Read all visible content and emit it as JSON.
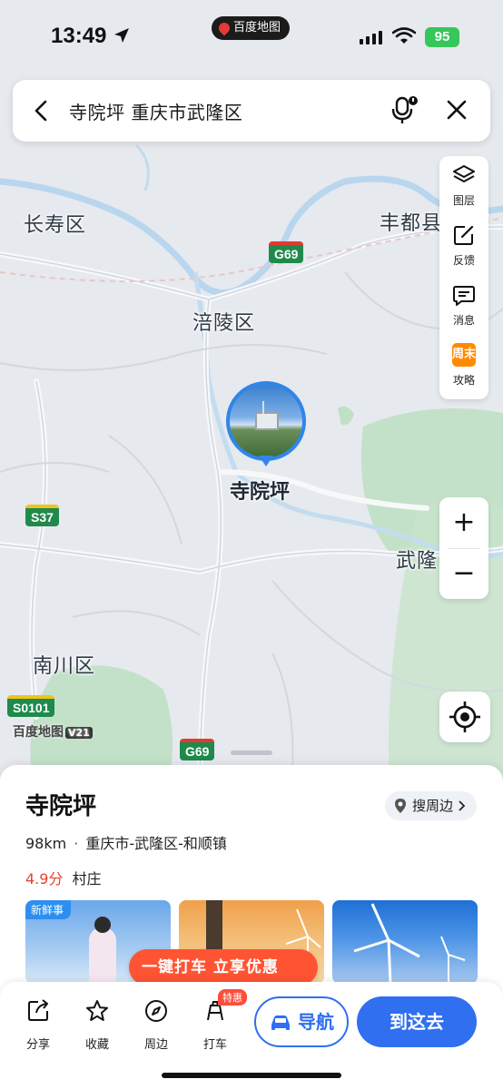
{
  "status_bar": {
    "time": "13:49",
    "app_name": "百度地图",
    "battery": "95"
  },
  "search": {
    "query": "寺院坪 重庆市武隆区"
  },
  "map": {
    "labels": {
      "changshou": "长寿区",
      "fuling": "涪陵区",
      "fengdu": "丰都县",
      "wulong": "武隆",
      "nanchuan": "南川区"
    },
    "shields": {
      "g69_top": "G69",
      "s37": "S37",
      "s0101": "S0101",
      "g69_bottom": "G69"
    },
    "brand": "百度地图",
    "brand_version": "V21",
    "pin_label": "寺院坪"
  },
  "tools": [
    {
      "label": "图层",
      "icon": "layers-icon"
    },
    {
      "label": "反馈",
      "icon": "edit-icon"
    },
    {
      "label": "消息",
      "icon": "message-icon"
    },
    {
      "label": "攻略",
      "icon": "weekend-icon",
      "badge": "周末"
    }
  ],
  "zoom": {
    "in": "+",
    "out": "−"
  },
  "place": {
    "name": "寺院坪",
    "nearby_label": "搜周边",
    "distance": "98km",
    "address": "重庆市-武隆区-和顺镇",
    "rating": "4.9分",
    "category": "村庄"
  },
  "photos": {
    "fresh_badge": "新鲜事",
    "promo": "一键打车 立享优惠"
  },
  "actions": [
    {
      "label": "分享",
      "icon": "share-icon"
    },
    {
      "label": "收藏",
      "icon": "star-icon"
    },
    {
      "label": "周边",
      "icon": "compass-icon"
    },
    {
      "label": "打车",
      "icon": "taxi-icon",
      "badge": "特惠"
    }
  ],
  "buttons": {
    "navigate": "导航",
    "go_here": "到这去"
  },
  "colors": {
    "accent": "#2f6ff0",
    "rating": "#e8412c",
    "pin": "#2f86e8"
  }
}
